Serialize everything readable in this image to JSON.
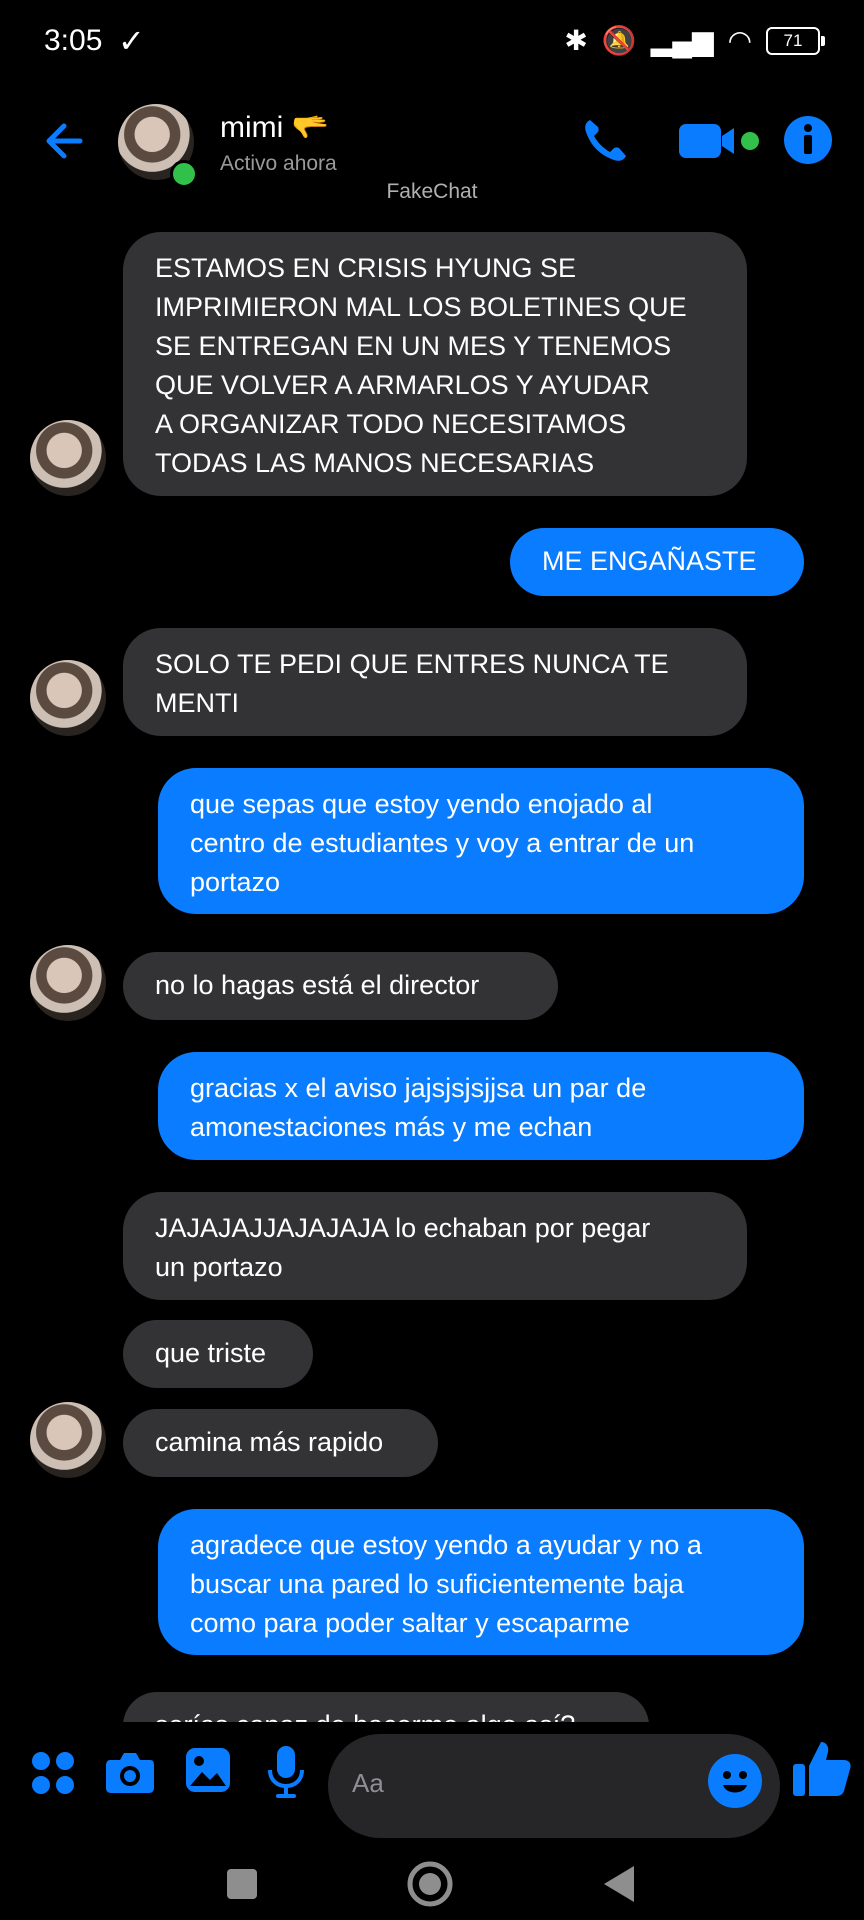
{
  "status_bar": {
    "time": "3:05",
    "battery": "71"
  },
  "header": {
    "contact_name": "mimi",
    "contact_emoji": "🫳",
    "presence": "Activo ahora"
  },
  "watermark": "FakeChat",
  "messages": [
    {
      "dir": "in",
      "lines": [
        "ESTAMOS EN CRISIS HYUNG SE",
        "IMPRIMIERON MAL LOS BOLETINES QUE",
        "SE ENTREGAN EN UN MES Y TENEMOS",
        "QUE VOLVER A ARMARLOS Y AYUDAR",
        "A ORGANIZAR TODO NECESITAMOS",
        "TODAS LAS MANOS NECESARIAS"
      ]
    },
    {
      "dir": "out",
      "lines": [
        "ME ENGAÑASTE"
      ]
    },
    {
      "dir": "in",
      "lines": [
        "SOLO TE PEDI QUE ENTRES NUNCA TE",
        "MENTI"
      ]
    },
    {
      "dir": "out",
      "lines": [
        "que sepas que estoy yendo enojado al",
        "centro de estudiantes y voy a entrar de un",
        "portazo"
      ]
    },
    {
      "dir": "in",
      "lines": [
        "no lo hagas está el director"
      ]
    },
    {
      "dir": "out",
      "lines": [
        "gracias x el aviso jajsjsjsjjsa un par de",
        "amonestaciones más y me echan"
      ]
    },
    {
      "dir": "in",
      "lines": [
        "JAJAJAJJAJAJAJA lo echaban por pegar",
        "un portazo"
      ]
    },
    {
      "dir": "in",
      "lines": [
        "que triste"
      ]
    },
    {
      "dir": "in",
      "lines": [
        "camina más rapido"
      ]
    },
    {
      "dir": "out",
      "lines": [
        "agradece que estoy yendo a ayudar y no a",
        "buscar una pared lo suficientemente baja",
        "como para poder saltar y escaparme"
      ]
    },
    {
      "dir": "in",
      "lines": [
        "serías capaz de hacerme algo así?"
      ]
    }
  ],
  "composer": {
    "placeholder": "Aa"
  }
}
